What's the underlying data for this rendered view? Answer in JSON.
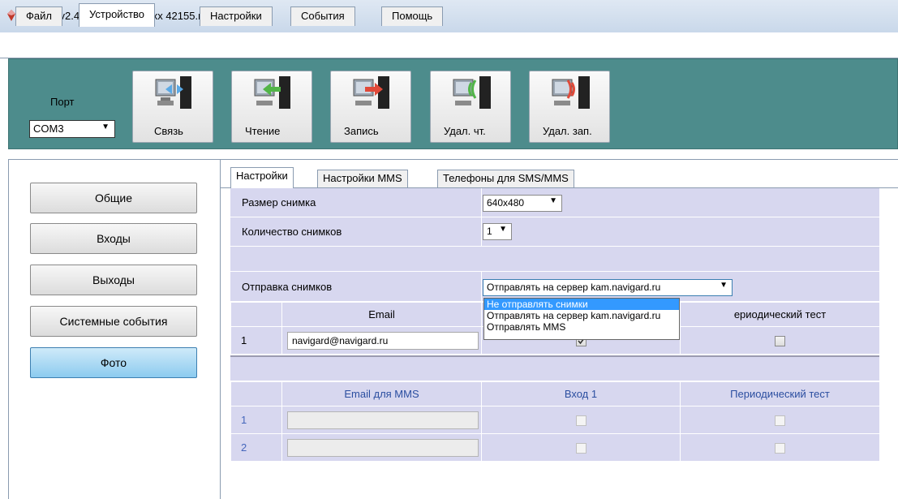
{
  "window": {
    "title": "NV Pro v2.4.21 NV8704 v1.xx 42155.nvp*"
  },
  "menu": {
    "tabs": [
      "Файл",
      "Устройство",
      "Настройки",
      "События",
      "Помощь"
    ],
    "active": "Устройство"
  },
  "ribbon": {
    "port_label": "Порт",
    "port_value": "COM3",
    "buttons": [
      "Связь",
      "Чтение",
      "Запись",
      "Удал. чт.",
      "Удал. зап."
    ]
  },
  "sidebar": {
    "items": [
      "Общие",
      "Входы",
      "Выходы",
      "Системные события",
      "Фото"
    ],
    "active": "Фото"
  },
  "tabs": {
    "items": [
      "Настройки",
      "Настройки MMS",
      "Телефоны для SMS/MMS"
    ],
    "active": "Настройки"
  },
  "form": {
    "size_label": "Размер снимка",
    "size_value": "640x480",
    "count_label": "Количество снимков",
    "count_value": "1",
    "send_label": "Отправка снимков",
    "send_value": "Отправлять на сервер kam.navigard.ru"
  },
  "dropdown": {
    "options": [
      "Не отправлять снимки",
      "Отправлять на сервер kam.navigard.ru",
      "Отправлять MMS"
    ],
    "selected": "Не отправлять снимки"
  },
  "email_table": {
    "headers": [
      "",
      "Email",
      "",
      "ериодический тест"
    ],
    "rows": [
      {
        "num": "1",
        "email": "navigard@navigard.ru",
        "input1": true,
        "periodic": false
      }
    ]
  },
  "mms_table": {
    "headers": [
      "",
      "Email для MMS",
      "Вход 1",
      "Периодический тест"
    ],
    "rows": [
      {
        "num": "1",
        "email": "",
        "input1": false,
        "periodic": false
      },
      {
        "num": "2",
        "email": "",
        "input1": false,
        "periodic": false
      }
    ]
  },
  "colors": {
    "ribbon": "#4d8c8c",
    "grid": "#d7d7ef",
    "active_button": "#8ccbef",
    "selection": "#3399ff",
    "table_row_number": "#4466bb"
  },
  "icons": {
    "app": "app-icon",
    "ribbon": [
      "connect-icon",
      "read-icon",
      "write-icon",
      "remote-read-icon",
      "remote-write-icon"
    ]
  }
}
